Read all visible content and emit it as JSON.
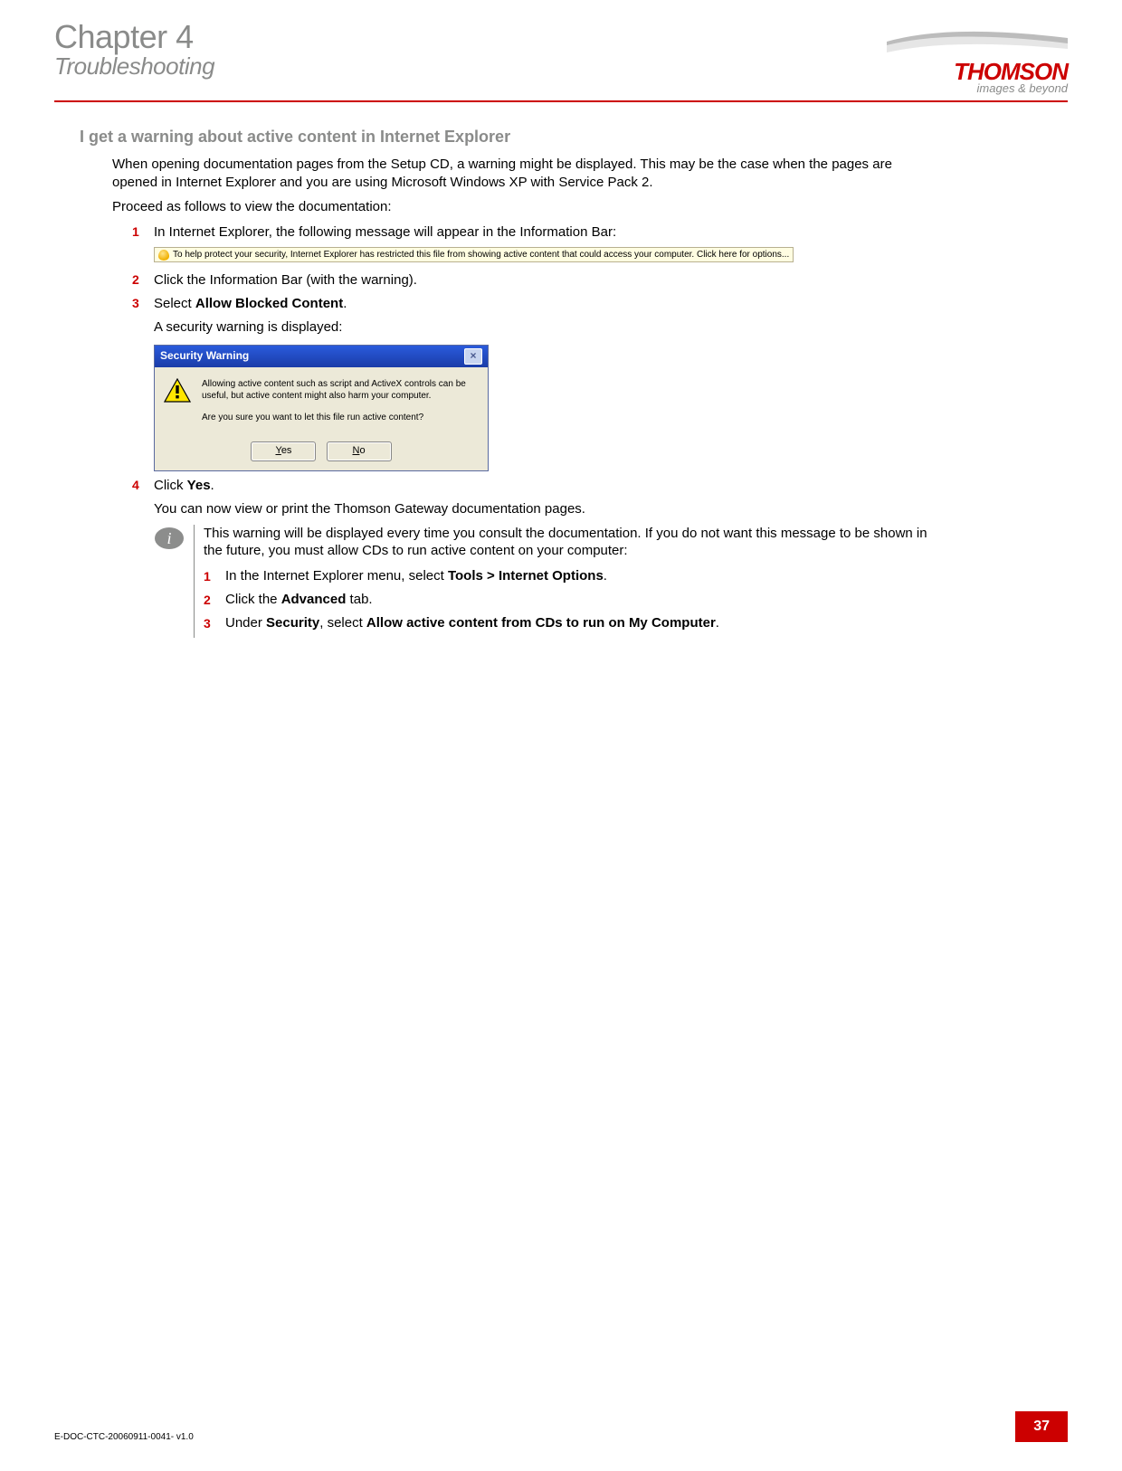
{
  "header": {
    "chapter": "Chapter 4",
    "subtitle": "Troubleshooting",
    "brand": "THOMSON",
    "tagline": "images & beyond"
  },
  "section_heading": "I get a warning about active content in Internet Explorer",
  "intro_para1": "When opening documentation pages from the Setup CD, a warning might be displayed. This may be the case when the pages are opened in Internet Explorer and you are using Microsoft Windows XP with Service Pack 2.",
  "intro_para2": "Proceed as follows to view the documentation:",
  "steps": {
    "s1": {
      "num": "1",
      "text": "In Internet Explorer, the following message will appear in the Information Bar:",
      "infobar": "To help protect your security, Internet Explorer has restricted this file from showing active content that could access your computer. Click here for options..."
    },
    "s2": {
      "num": "2",
      "text": "Click the Information Bar (with the warning)."
    },
    "s3": {
      "num": "3",
      "prefix": "Select ",
      "bold": "Allow Blocked Content",
      "suffix": ".",
      "sub": "A security warning is displayed:"
    },
    "s4": {
      "num": "4",
      "prefix": "Click ",
      "bold": "Yes",
      "suffix": ".",
      "sub": "You can now view or print the Thomson Gateway documentation pages."
    }
  },
  "dialog": {
    "title": "Security Warning",
    "line1": "Allowing active content such as script and ActiveX controls can be useful, but active content might also harm your computer.",
    "line2": "Are you sure you want to let this file run active content?",
    "yes_u": "Y",
    "yes_r": "es",
    "no_u": "N",
    "no_r": "o"
  },
  "note": {
    "intro": "This warning will be displayed every time you consult the documentation. If you do not want this message to be shown in the future, you must allow CDs to run active content on your computer:",
    "n1": {
      "num": "1",
      "prefix": "In the Internet Explorer menu, select ",
      "bold": "Tools > Internet Options",
      "suffix": "."
    },
    "n2": {
      "num": "2",
      "prefix": "Click the ",
      "bold": "Advanced",
      "suffix": " tab."
    },
    "n3": {
      "num": "3",
      "prefix": "Under ",
      "bold1": "Security",
      "mid": ", select ",
      "bold2": "Allow active content from CDs to run on My Computer",
      "suffix": "."
    }
  },
  "footer": {
    "doc_id": "E-DOC-CTC-20060911-0041- v1.0",
    "page_num": "37"
  }
}
